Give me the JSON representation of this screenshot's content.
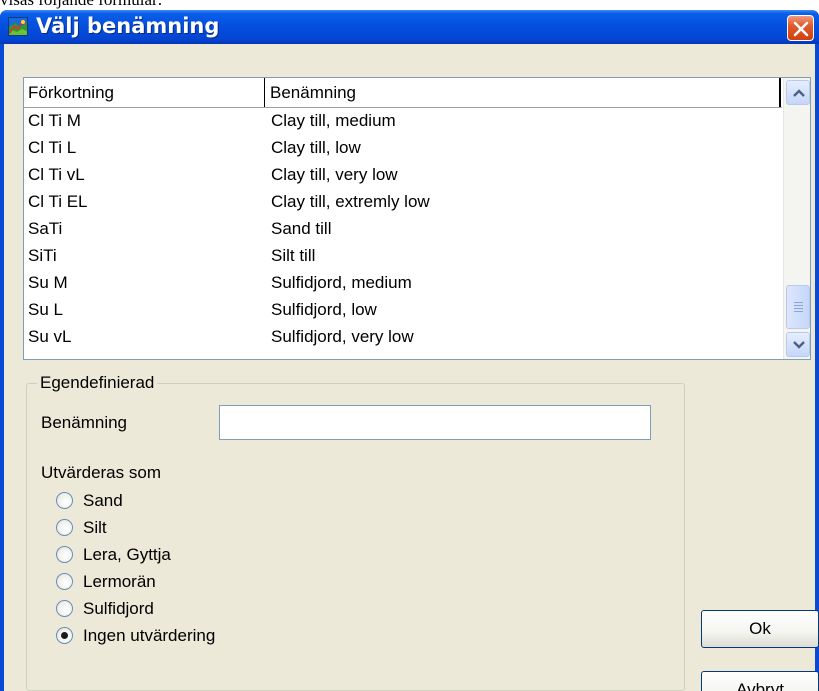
{
  "document": {
    "above_text": "visas följande formulär:"
  },
  "window": {
    "title": "Välj benämning",
    "accent_color": "#0a49d6",
    "close_icon": "close-icon"
  },
  "list": {
    "headers": [
      "Förkortning",
      "Benämning"
    ],
    "rows": [
      {
        "abbr": "Cl Ti M",
        "name": "Clay till, medium"
      },
      {
        "abbr": "Cl Ti L",
        "name": "Clay till, low"
      },
      {
        "abbr": "Cl Ti vL",
        "name": "Clay till, very low"
      },
      {
        "abbr": "Cl Ti EL",
        "name": "Clay till, extremly low"
      },
      {
        "abbr": "SaTi",
        "name": "Sand till"
      },
      {
        "abbr": "SiTi",
        "name": "Silt till"
      },
      {
        "abbr": "Su M",
        "name": "Sulfidjord, medium"
      },
      {
        "abbr": "Su L",
        "name": "Sulfidjord, low"
      },
      {
        "abbr": "Su vL",
        "name": "Sulfidjord, very low"
      }
    ],
    "scroll_position": 0.9
  },
  "custom": {
    "group_title": "Egendefinierad",
    "name_label": "Benämning",
    "name_value": "",
    "evaluate_label": "Utvärderas som",
    "options": [
      {
        "label": "Sand",
        "selected": false
      },
      {
        "label": "Silt",
        "selected": false
      },
      {
        "label": "Lera, Gyttja",
        "selected": false
      },
      {
        "label": "Lermorän",
        "selected": false
      },
      {
        "label": "Sulfidjord",
        "selected": false
      },
      {
        "label": "Ingen utvärdering",
        "selected": true
      }
    ]
  },
  "buttons": {
    "ok": "Ok",
    "cancel": "Avbryt"
  }
}
